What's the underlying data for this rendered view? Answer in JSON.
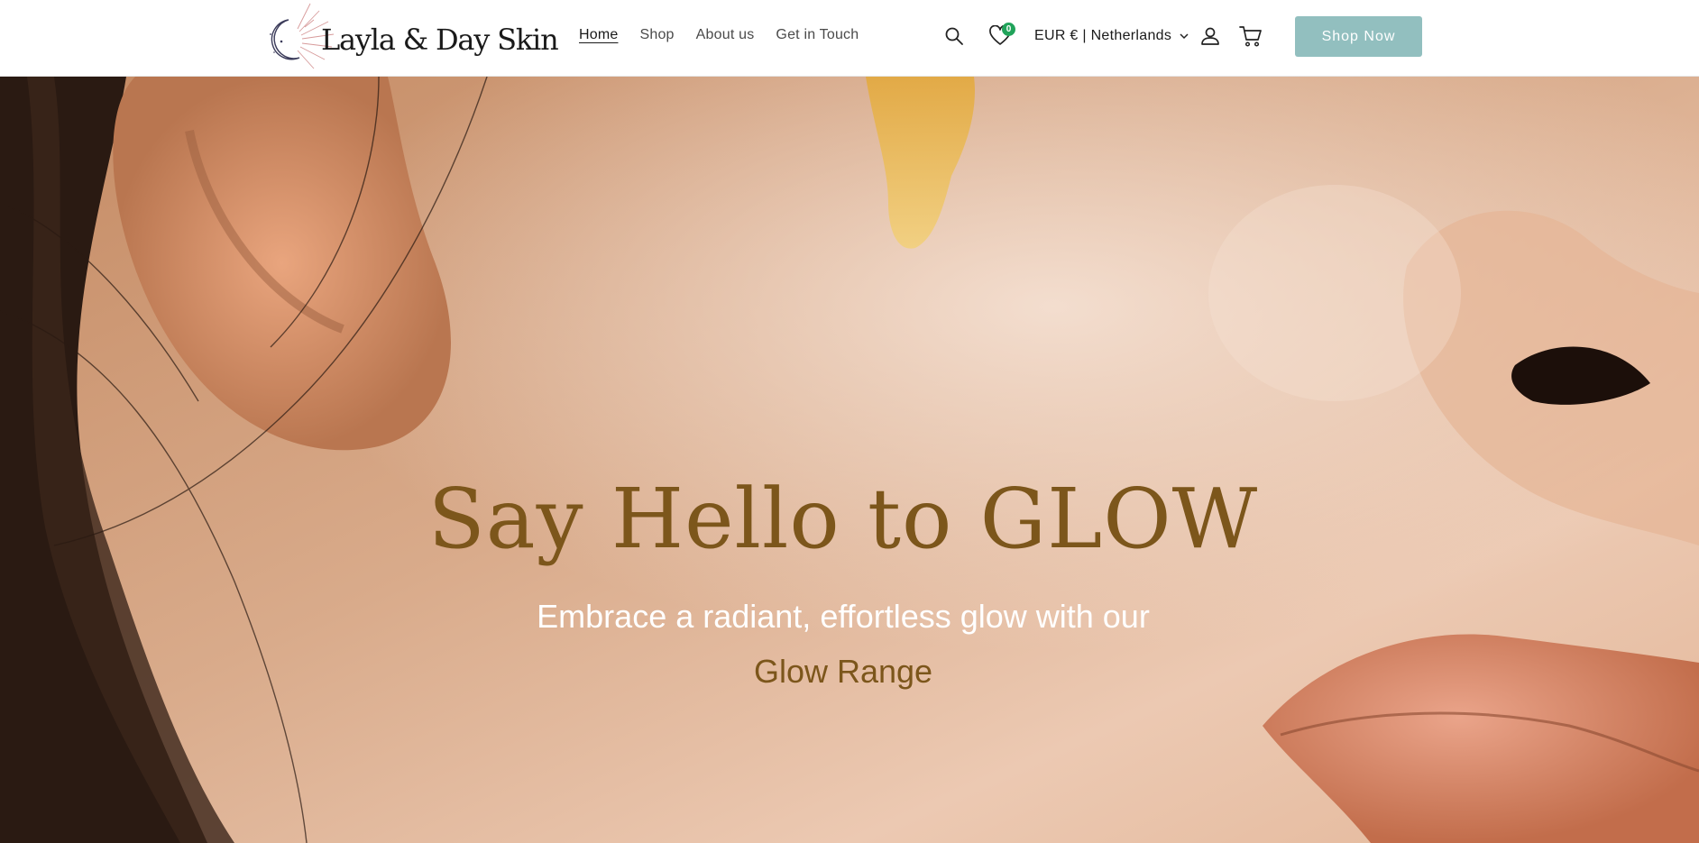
{
  "header": {
    "logo_text": "Layla & Day Skin",
    "nav": [
      {
        "label": "Home",
        "active": true
      },
      {
        "label": "Shop",
        "active": false
      },
      {
        "label": "About us",
        "active": false
      },
      {
        "label": "Get in Touch",
        "active": false
      }
    ],
    "icons": {
      "search": "search-icon",
      "wishlist": "heart-icon",
      "account": "user-icon",
      "cart": "cart-icon"
    },
    "wishlist_count": "0",
    "currency_label": "EUR € | Netherlands",
    "cta_label": "Shop Now"
  },
  "hero": {
    "title": "Say Hello to GLOW",
    "subtitle": "Embrace a radiant, effortless glow with our",
    "subtitle_highlight": "Glow Range"
  },
  "colors": {
    "cta_background": "#92bfbf",
    "title_color": "#7c561b",
    "badge_color": "#21a35a"
  }
}
